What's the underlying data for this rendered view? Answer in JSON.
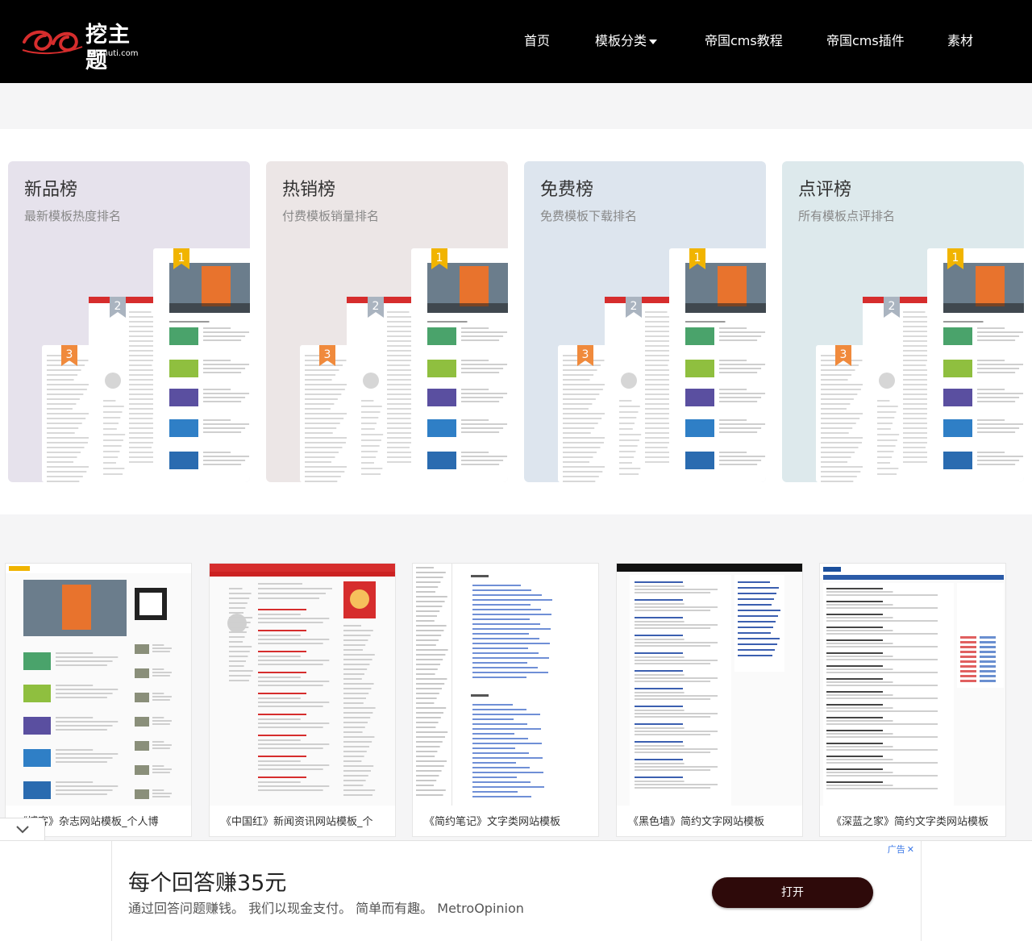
{
  "header": {
    "logo_text": "挖主题",
    "logo_sub": "wazhuti.com",
    "nav": [
      {
        "label": "首页"
      },
      {
        "label": "模板分类"
      },
      {
        "label": "帝国cms教程"
      },
      {
        "label": "帝国cms插件"
      },
      {
        "label": "素材"
      }
    ]
  },
  "rankings": [
    {
      "title": "新品榜",
      "subtitle": "最新模板热度排名",
      "bg": "#e6e2ec"
    },
    {
      "title": "热销榜",
      "subtitle": "付费模板销量排名",
      "bg": "#ece6e6"
    },
    {
      "title": "免费榜",
      "subtitle": "免费模板下载排名",
      "bg": "#dde5ee"
    },
    {
      "title": "点评榜",
      "subtitle": "所有模板点评排名",
      "bg": "#dde9ec"
    }
  ],
  "badges": [
    "1",
    "2",
    "3"
  ],
  "templates": [
    {
      "caption": "《博客》杂志网站模板_个人博"
    },
    {
      "caption": "《中国红》新闻资讯网站模板_个"
    },
    {
      "caption": "《简约笔记》文字类网站模板"
    },
    {
      "caption": "《黑色墙》简约文字网站模板"
    },
    {
      "caption": "《深蓝之家》简约文字类网站模板"
    }
  ],
  "ad": {
    "label": "广告",
    "close": "✕",
    "headline": "每个回答赚35元",
    "body": "通过回答问题赚钱。 我们以现金支付。 简单而有趣。 MetroOpinion",
    "button": "打开"
  },
  "colors": {
    "header_bg": "#000000",
    "accent_red": "#d62d2d",
    "badge_gold": "#f1b400",
    "badge_silver": "#aab4c0",
    "badge_orange": "#f08a3c"
  }
}
